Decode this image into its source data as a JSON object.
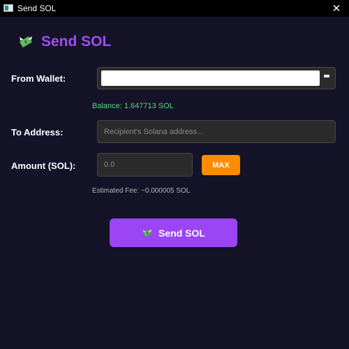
{
  "window": {
    "title": "Send SOL",
    "icon": "app-window-icon",
    "close_icon": "close-icon"
  },
  "heading": {
    "text": "Send SOL",
    "icon": "money-with-wings-icon",
    "color": "#9d4ef0"
  },
  "form": {
    "from_wallet": {
      "label": "From Wallet:",
      "value": "",
      "icon": "dropdown-icon"
    },
    "balance": "Balance: 1.647713 SOL",
    "to_address": {
      "label": "To Address:",
      "value": "",
      "placeholder": "Recipient's Solana address..."
    },
    "amount": {
      "label": "Amount (SOL):",
      "value": "",
      "placeholder": "0.0"
    },
    "max_button": "MAX",
    "estimated_fee": "Estimated Fee: ~0.000005 SOL"
  },
  "send_button": {
    "label": "Send SOL",
    "icon": "money-with-wings-icon",
    "color": "#9b45f5"
  },
  "colors": {
    "background": "#141328",
    "accent": "#9d4ef0",
    "balance": "#58d67f",
    "max_button": "#ff8c00"
  }
}
